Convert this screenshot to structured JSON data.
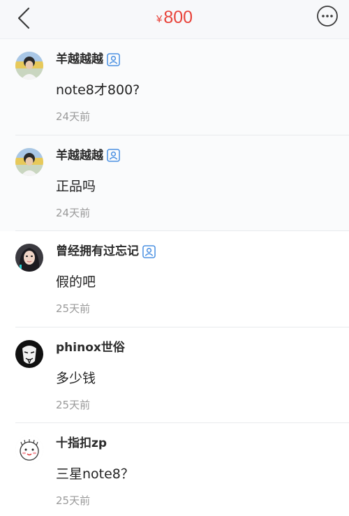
{
  "header": {
    "currency_symbol": "¥",
    "price": "800",
    "back_icon": "chevron-left-icon",
    "more_icon": "more-horizontal-icon",
    "accent_color": "#e8433a"
  },
  "comments": [
    {
      "username": "羊越越越",
      "verified": true,
      "text": "note8才800?",
      "time": "24天前",
      "avatar": "avatar-boy-photo"
    },
    {
      "username": "羊越越越",
      "verified": true,
      "text": "正品吗",
      "time": "24天前",
      "avatar": "avatar-boy-photo"
    },
    {
      "username": "曾经拥有过忘记",
      "verified": true,
      "text": "假的吧",
      "time": "25天前",
      "avatar": "avatar-girl-photo"
    },
    {
      "username": "phinox世俗",
      "verified": false,
      "text": "多少钱",
      "time": "25天前",
      "avatar": "avatar-mask"
    },
    {
      "username": "十指扣zp",
      "verified": false,
      "text": "三星note8？",
      "time": "25天前",
      "avatar": "avatar-cartoon"
    }
  ]
}
